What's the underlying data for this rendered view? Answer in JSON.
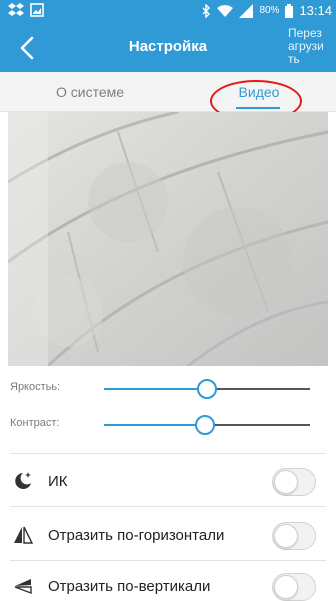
{
  "status_bar": {
    "battery": "80%",
    "time": "13:14"
  },
  "header": {
    "title": "Настройка",
    "reload_label": "Перез агрузи ть"
  },
  "tabs": [
    {
      "label": "О системе",
      "selected": false
    },
    {
      "label": "Видео",
      "selected": true
    }
  ],
  "sliders": [
    {
      "label": "Яркостьь:",
      "value": 0.5
    },
    {
      "label": "Контраст:",
      "value": 0.49
    }
  ],
  "toggles": [
    {
      "label": "ИК",
      "icon": "moon-star-icon",
      "on": false
    },
    {
      "label": "Отразить по-горизонтали",
      "icon": "flip-horizontal-icon",
      "on": false
    },
    {
      "label": "Отразить по-вертикали",
      "icon": "flip-vertical-icon",
      "on": false
    }
  ],
  "colors": {
    "accent": "#2f9ad6",
    "annotation": "#e11a1a"
  }
}
